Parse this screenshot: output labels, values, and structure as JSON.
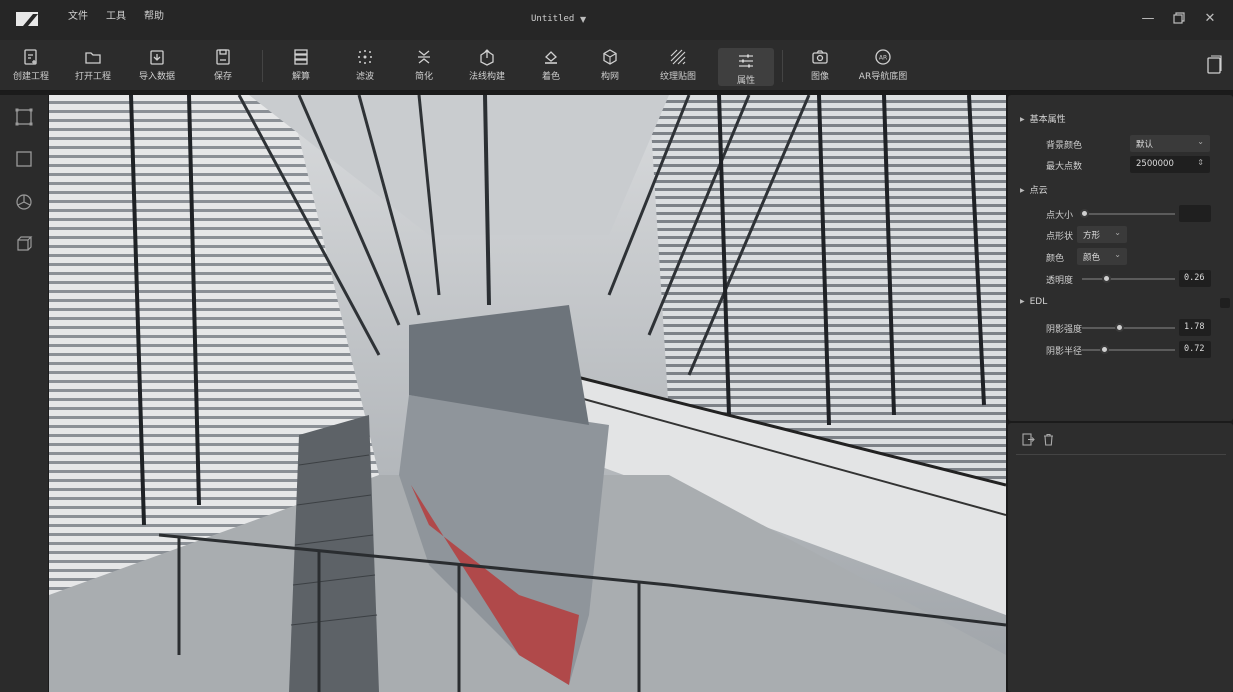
{
  "app": {
    "document_title": "Untitled"
  },
  "menu": [
    "文件",
    "工具",
    "帮助"
  ],
  "toolbar": [
    {
      "label": "创建工程",
      "icon": "new-project-icon"
    },
    {
      "label": "打开工程",
      "icon": "folder-icon"
    },
    {
      "label": "导入数据",
      "icon": "import-icon"
    },
    {
      "label": "保存",
      "icon": "save-icon"
    },
    {
      "label": "解算",
      "icon": "stack-icon"
    },
    {
      "label": "滤波",
      "icon": "filter-icon"
    },
    {
      "label": "简化",
      "icon": "simplify-icon"
    },
    {
      "label": "法线构建",
      "icon": "normal-icon"
    },
    {
      "label": "着色",
      "icon": "paint-icon"
    },
    {
      "label": "构网",
      "icon": "mesh-icon"
    },
    {
      "label": "纹理贴图",
      "icon": "texture-icon"
    },
    {
      "label": "属性",
      "icon": "sliders-icon",
      "active": true
    },
    {
      "label": "图像",
      "icon": "camera-icon"
    },
    {
      "label": "AR导航底图",
      "icon": "ar-icon"
    }
  ],
  "properties": {
    "basic": {
      "title": "基本属性",
      "bg_color_label": "背景颜色",
      "bg_color_value": "默认",
      "max_points_label": "最大点数",
      "max_points_value": "2500000"
    },
    "pointcloud": {
      "title": "点云",
      "point_size_label": "点大小",
      "point_size_fraction": 0.0,
      "point_shape_label": "点形状",
      "point_shape_value": "方形",
      "color_label": "颜色",
      "color_value": "颜色",
      "opacity_label": "透明度",
      "opacity_value": "0.26",
      "opacity_fraction": 0.26
    },
    "edl": {
      "title": "EDL",
      "strength_label": "阴影强度",
      "strength_value": "1.78",
      "strength_fraction": 0.36,
      "radius_label": "阴影半径",
      "radius_value": "0.72",
      "radius_fraction": 0.24
    }
  },
  "colors": {
    "background": "#1b1b1b",
    "panel": "#2d2d2d",
    "toolbar": "#2c2c2c",
    "active_tool": "#3f3f3f"
  }
}
